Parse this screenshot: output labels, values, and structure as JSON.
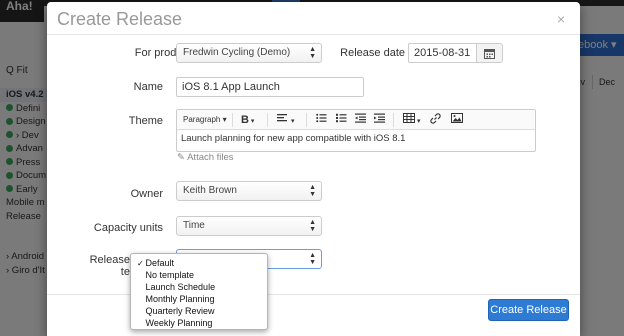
{
  "background": {
    "brand": "Aha!",
    "right_button": "ebook ▾",
    "toolbar_fit": "Q Fit",
    "columns": [
      "Nov",
      "Dec"
    ],
    "list": [
      {
        "label": "iOS v4.2",
        "group": true
      },
      {
        "label": "Defini",
        "dot": true
      },
      {
        "label": "Design",
        "dot": true
      },
      {
        "label": "› Dev",
        "dot": true
      },
      {
        "label": "Advan",
        "dot": true
      },
      {
        "label": "Press",
        "dot": true
      },
      {
        "label": "Docum",
        "dot": true
      },
      {
        "label": "Early",
        "dot": true
      },
      {
        "label": "Mobile m",
        "dot": false
      },
      {
        "label": "Release",
        "dot": false
      }
    ],
    "bottom": [
      "› Android",
      "› Giro d'It"
    ]
  },
  "modal": {
    "title": "Create Release",
    "close": "×",
    "labels": {
      "product": "For product",
      "release_date": "Release date",
      "name": "Name",
      "theme": "Theme",
      "owner": "Owner",
      "capacity_units": "Capacity units",
      "phase_template": "Release phase template"
    },
    "product_value": "Fredwin Cycling (Demo)",
    "release_date_value": "2015-08-31",
    "name_value": "iOS 8.1 App Launch",
    "editor": {
      "paragraph": "Paragraph ▾",
      "bold": "B",
      "text": "Launch planning for new app compatible with iOS 8.1"
    },
    "attach_files": "Attach files",
    "owner_value": "Keith Brown",
    "capacity_value": "Time",
    "phase_options": [
      "Default",
      "No template",
      "Launch Schedule",
      "Monthly Planning",
      "Quarterly Review",
      "Weekly Planning"
    ],
    "phase_selected": "Default",
    "create_button": "Create Release"
  }
}
